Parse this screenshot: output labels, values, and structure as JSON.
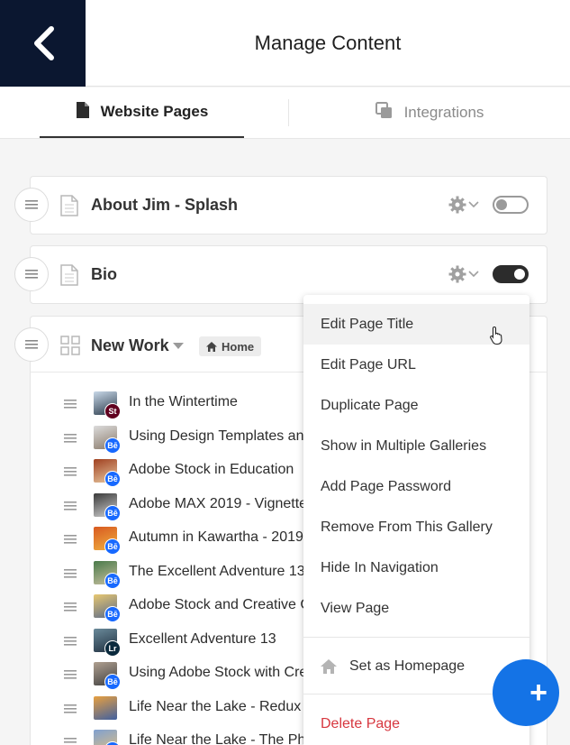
{
  "header": {
    "title": "Manage Content"
  },
  "tabs": [
    {
      "label": "Website Pages",
      "active": true
    },
    {
      "label": "Integrations",
      "active": false
    }
  ],
  "pages": [
    {
      "title": "About Jim - Splash",
      "enabled": false
    },
    {
      "title": "Bio",
      "enabled": true
    },
    {
      "title": "New Work",
      "badge": "Home"
    }
  ],
  "gallery_items": [
    {
      "title": "In the Wintertime",
      "badge": "St",
      "badge_color": "#61001f"
    },
    {
      "title": "Using Design Templates and",
      "badge": "Bē",
      "badge_color": "#1769ff"
    },
    {
      "title": "Adobe Stock in Education",
      "badge": "Bē",
      "badge_color": "#1769ff"
    },
    {
      "title": "Adobe MAX 2019 - Vignettes",
      "badge": "Bē",
      "badge_color": "#1769ff"
    },
    {
      "title": "Autumn in Kawartha - 2019",
      "badge": "Bē",
      "badge_color": "#1769ff"
    },
    {
      "title": "The Excellent Adventure 13",
      "badge": "Bē",
      "badge_color": "#1769ff"
    },
    {
      "title": "Adobe Stock and Creative C",
      "badge": "Bē",
      "badge_color": "#1769ff"
    },
    {
      "title": "Excellent Adventure 13",
      "badge": "Lr",
      "badge_color": "#0b2a3d"
    },
    {
      "title": "Using Adobe Stock with Cre",
      "badge": "Bē",
      "badge_color": "#1769ff"
    },
    {
      "title": "Life Near the Lake - Redux",
      "badge": "",
      "badge_color": ""
    },
    {
      "title": "Life Near the Lake - The Pho",
      "badge": "Bē",
      "badge_color": "#1769ff"
    }
  ],
  "menu": {
    "items": [
      "Edit Page Title",
      "Edit Page URL",
      "Duplicate Page",
      "Show in Multiple Galleries",
      "Add Page Password",
      "Remove From This Gallery",
      "Hide In Navigation",
      "View Page"
    ],
    "set_homepage": "Set as Homepage",
    "delete": "Delete Page"
  },
  "fab": {
    "label": "+"
  },
  "colors": {
    "header_dark": "#0b1730",
    "accent": "#1473e6",
    "danger": "#d7373f"
  }
}
